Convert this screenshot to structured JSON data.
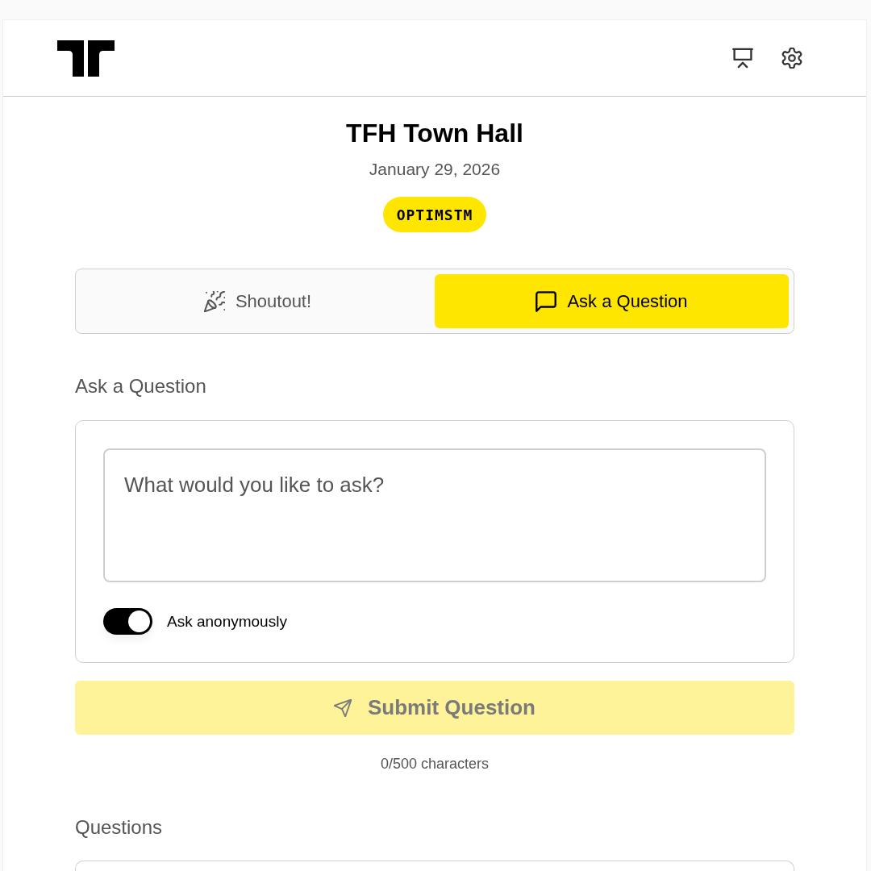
{
  "event": {
    "title": "TFH Town Hall",
    "date": "January 29, 2026",
    "badge": "OPTIMSTM"
  },
  "tabs": [
    {
      "kind": "shoutout",
      "label": "Shoutout!",
      "selected": false
    },
    {
      "kind": "question",
      "label": "Ask a Question",
      "selected": true
    }
  ],
  "form": {
    "heading": "Ask a Question",
    "question_field": {
      "placeholder": "What would you like to ask?"
    },
    "anonymous_toggle": {
      "label": "Ask anonymously",
      "on": true
    },
    "submit_button": {
      "label": "Submit Question",
      "disabled": true
    },
    "char_count": "0/500 characters"
  },
  "questions": {
    "heading": "Questions"
  }
}
